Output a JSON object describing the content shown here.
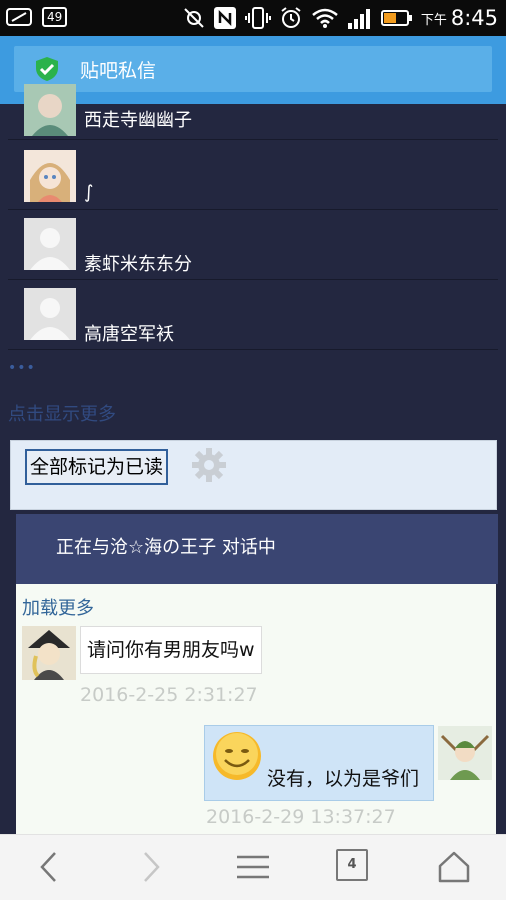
{
  "status_bar": {
    "battery_level": "49",
    "time_prefix": "下午",
    "time": "8:45",
    "icons": [
      "screenshot-icon",
      "battery-saver-icon",
      "no-location-icon",
      "nfc-icon",
      "vibrate-icon",
      "alarm-icon",
      "wifi-icon",
      "signal-icon",
      "battery-icon"
    ]
  },
  "titlebar": {
    "title": "贴吧私信",
    "icon": "shield-check-icon",
    "accent_color": "#3d9be0"
  },
  "contacts": [
    {
      "name": "西走寺幽幽子",
      "avatar": "anime-avatar"
    },
    {
      "name": "∫",
      "avatar": "anime-girl-avatar"
    },
    {
      "name": "素虾米东东分",
      "avatar": "default-avatar"
    },
    {
      "name": "高唐空军袄",
      "avatar": "default-avatar"
    }
  ],
  "ellipsis": "•••",
  "show_more": "点击显示更多",
  "mark_all_read": "全部标记为已读",
  "chat": {
    "header": "正在与沧☆海の王子 对话中",
    "load_more": "加载更多",
    "messages": [
      {
        "direction": "in",
        "text": "请问你有男朋友吗w",
        "time": "2016-2-25 2:31:27"
      },
      {
        "direction": "out",
        "text": "没有，以为是爷们",
        "time": "2016-2-29 13:37:27"
      }
    ]
  },
  "nav": {
    "tab_count": "4",
    "buttons": [
      "back-icon",
      "forward-icon",
      "menu-icon",
      "tabs-icon",
      "home-icon"
    ]
  }
}
